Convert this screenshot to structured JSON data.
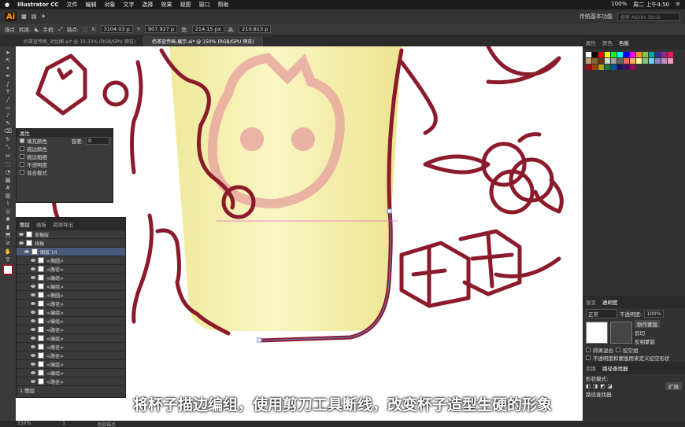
{
  "mac_menu": {
    "app": "Illustrator CC",
    "items": [
      "文件",
      "编辑",
      "对象",
      "文字",
      "选择",
      "效果",
      "视图",
      "窗口",
      "帮助"
    ],
    "battery": "100%",
    "clock": "周二 上午4:50"
  },
  "app_bar": {
    "logo": "Ai",
    "workspace": "传统基本功能",
    "search_placeholder": "搜索 Adobe Stock"
  },
  "control_bar": {
    "mode": "锚点",
    "convert": "转换:",
    "handles": "手柄:",
    "anchors": "锚点:",
    "x_label": "X:",
    "x": "3104.03 p",
    "y_label": "Y:",
    "y": "907.927 p",
    "w_label": "宽:",
    "w": "214.15 px",
    "h_label": "高:",
    "h": "210.813 p"
  },
  "doc_tabs": [
    {
      "label": "奶茶宣传图_对比图.ai* @ 33.33% (RGB/GPU 预览)"
    },
    {
      "label": "奶茶宣传画-展示.ai* @ 150% (RGB/GPU 预览)",
      "active": true
    }
  ],
  "appearance_panel": {
    "title": "属性",
    "fill": "填充颜色",
    "opacity_label": "容差:",
    "opacity": "0",
    "stroke_color": "描边颜色",
    "stroke_weight": "描边粗细",
    "transparency": "不透明度",
    "blend": "混合模式"
  },
  "layers_panel": {
    "tabs": [
      "图层",
      "画板",
      "资源导出"
    ],
    "layers": [
      {
        "name": "草稿版"
      },
      {
        "name": "线稿"
      },
      {
        "name": "图层 14"
      },
      {
        "name": "<椭圆>"
      },
      {
        "name": "<路径>"
      },
      {
        "name": "<编组>"
      },
      {
        "name": "<编组>"
      },
      {
        "name": "<椭圆>"
      },
      {
        "name": "<路径>"
      },
      {
        "name": "<编组>"
      },
      {
        "name": "<编组>"
      },
      {
        "name": "<路径>"
      },
      {
        "name": "<编组>"
      },
      {
        "name": "<路径>"
      },
      {
        "name": "<路径>"
      },
      {
        "name": "<编组>"
      },
      {
        "name": "<编组>"
      },
      {
        "name": "<路径>"
      }
    ],
    "footer": "1 图层"
  },
  "right_panel": {
    "tabs": [
      "属性",
      "颜色",
      "色板"
    ],
    "transparency_tabs": [
      "渐变",
      "透明度"
    ],
    "blend_mode": "正常",
    "opacity_label": "不透明度:",
    "opacity": "100%",
    "make_mask": "制作蒙版",
    "clip": "剪切",
    "invert": "反相蒙版",
    "isolate": "隔离混合",
    "knockout": "挖空组",
    "define_knockout": "不透明度和蒙版用来定义挖空形状",
    "pathfinder_tabs": [
      "变换",
      "路径查找器"
    ],
    "shape_modes": "形状模式:",
    "expand": "扩展",
    "pathfinders": "路径查找器:"
  },
  "status_bar": {
    "zoom": "150%",
    "page": "1",
    "tool": "添加锚点"
  },
  "subtitle": "将杯子描边编组，使用剪刀工具断线，改变杯子造型生硬的形象",
  "colors": {
    "stroke": "#8b1a2b",
    "cup": "#f4f0a8",
    "logo": "#e8a8a0",
    "guide": "#e066c8"
  }
}
